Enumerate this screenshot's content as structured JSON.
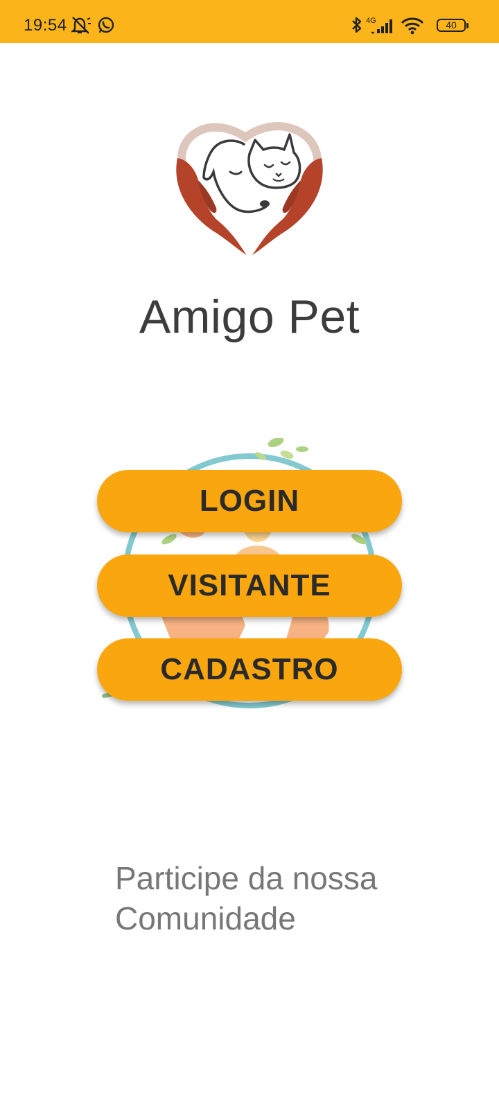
{
  "status_bar": {
    "time": "19:54",
    "battery": "40",
    "network": "4G",
    "background_color": "#FBB41A",
    "icons": [
      "alarm-off-icon",
      "whatsapp-icon",
      "bluetooth-icon",
      "signal-icon",
      "wifi-icon",
      "battery-icon"
    ]
  },
  "app": {
    "title": "Amigo Pet",
    "logo": "heart-hands-dog-cat-logo"
  },
  "buttons": {
    "login": "LOGIN",
    "visitor": "VISITANTE",
    "signup": "CADASTRO",
    "color": "#F9A60F"
  },
  "footer": {
    "community_line1": "Participe da nossa",
    "community_line2": "Comunidade"
  }
}
